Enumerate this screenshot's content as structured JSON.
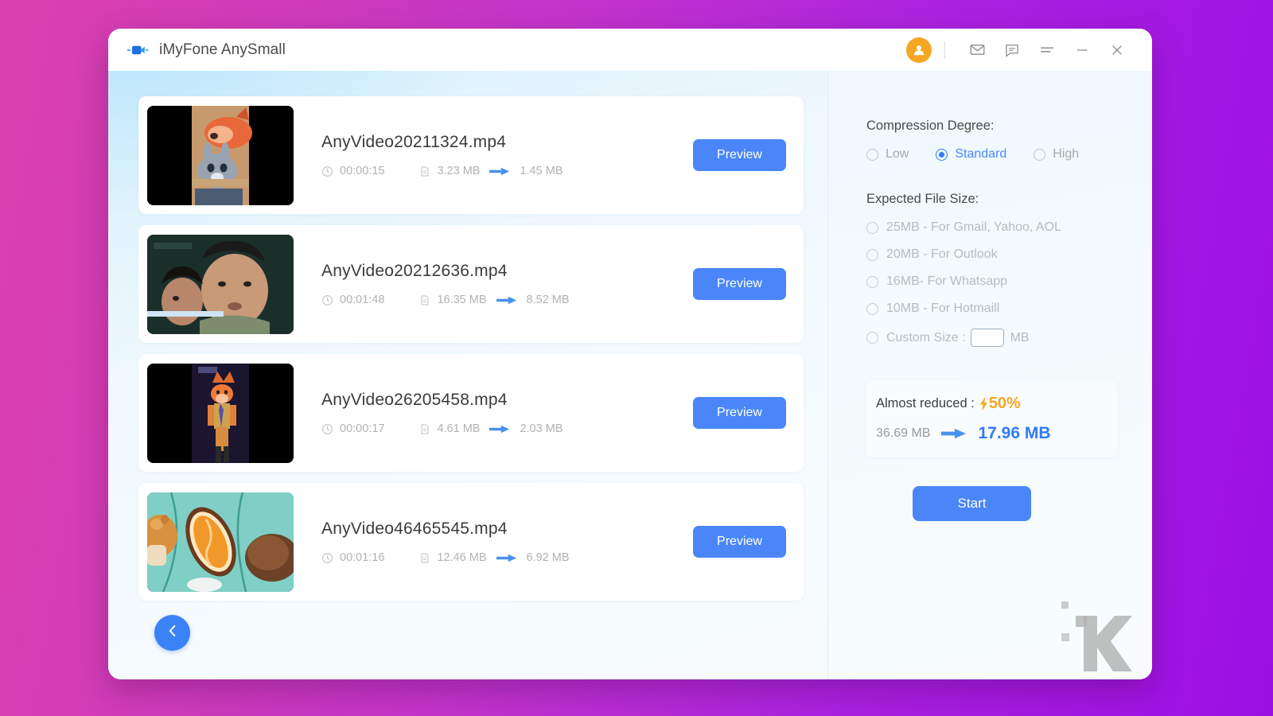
{
  "window": {
    "title": "iMyFone AnySmall",
    "logo_icon": "video-camera-icon"
  },
  "titlebar": {
    "avatar_icon": "user-avatar-icon",
    "mail_icon": "mail-icon",
    "feedback_icon": "chat-bubble-icon",
    "menu_icon": "hamburger-menu-icon",
    "minimize_icon": "minimize-icon",
    "close_icon": "close-icon"
  },
  "file_list": {
    "duration_icon": "clock-icon",
    "filesize_icon": "file-icon",
    "arrow_icon": "arrow-right-icon",
    "items": [
      {
        "name": "AnyVideo20211324.mp4",
        "duration": "00:00:15",
        "size_before": "3.23 MB",
        "size_after": "1.45 MB",
        "preview_label": "Preview",
        "thumbnail": "zootopia-fox-bunny-portrait"
      },
      {
        "name": "AnyVideo20212636.mp4",
        "duration": "00:01:48",
        "size_before": "16.35 MB",
        "size_after": "8.52 MB",
        "preview_label": "Preview",
        "thumbnail": "two-people-drama-scene"
      },
      {
        "name": "AnyVideo26205458.mp4",
        "duration": "00:00:17",
        "size_before": "4.61 MB",
        "size_after": "2.03 MB",
        "preview_label": "Preview",
        "thumbnail": "cartoon-fox-standing-portrait"
      },
      {
        "name": "AnyVideo46465545.mp4",
        "duration": "00:01:16",
        "size_before": "12.46 MB",
        "size_after": "6.92 MB",
        "preview_label": "Preview",
        "thumbnail": "cartoon-food-illustration"
      }
    ]
  },
  "navigation": {
    "back_icon": "chevron-left-icon"
  },
  "settings": {
    "compression_label": "Compression Degree:",
    "degrees": [
      {
        "label": "Low",
        "selected": false
      },
      {
        "label": "Standard",
        "selected": true
      },
      {
        "label": "High",
        "selected": false
      }
    ],
    "expected_size_label": "Expected File Size:",
    "size_options": [
      {
        "label": "25MB - For Gmail, Yahoo, AOL",
        "selected": false
      },
      {
        "label": "20MB - For Outlook",
        "selected": false
      },
      {
        "label": "16MB- For Whatsapp",
        "selected": false
      },
      {
        "label": "10MB - For Hotmaill",
        "selected": false
      }
    ],
    "custom": {
      "label": "Custom Size :",
      "value": "",
      "placeholder": "",
      "unit": "MB",
      "selected": false
    }
  },
  "summary": {
    "reduced_label": "Almost reduced :",
    "bolt_icon": "lightning-bolt-icon",
    "percent": "50%",
    "total_before": "36.69 MB",
    "total_after": "17.96 MB",
    "arrow_icon": "arrow-right-icon"
  },
  "actions": {
    "start_label": "Start"
  },
  "watermark": {
    "name": "knowtechie-k-watermark"
  },
  "colors": {
    "accent_blue": "#4a86f7",
    "accent_orange": "#f5a623",
    "muted_text": "#b2b2b2",
    "bg_gradient_start": "#d940ae",
    "bg_gradient_end": "#9c0fe4"
  }
}
